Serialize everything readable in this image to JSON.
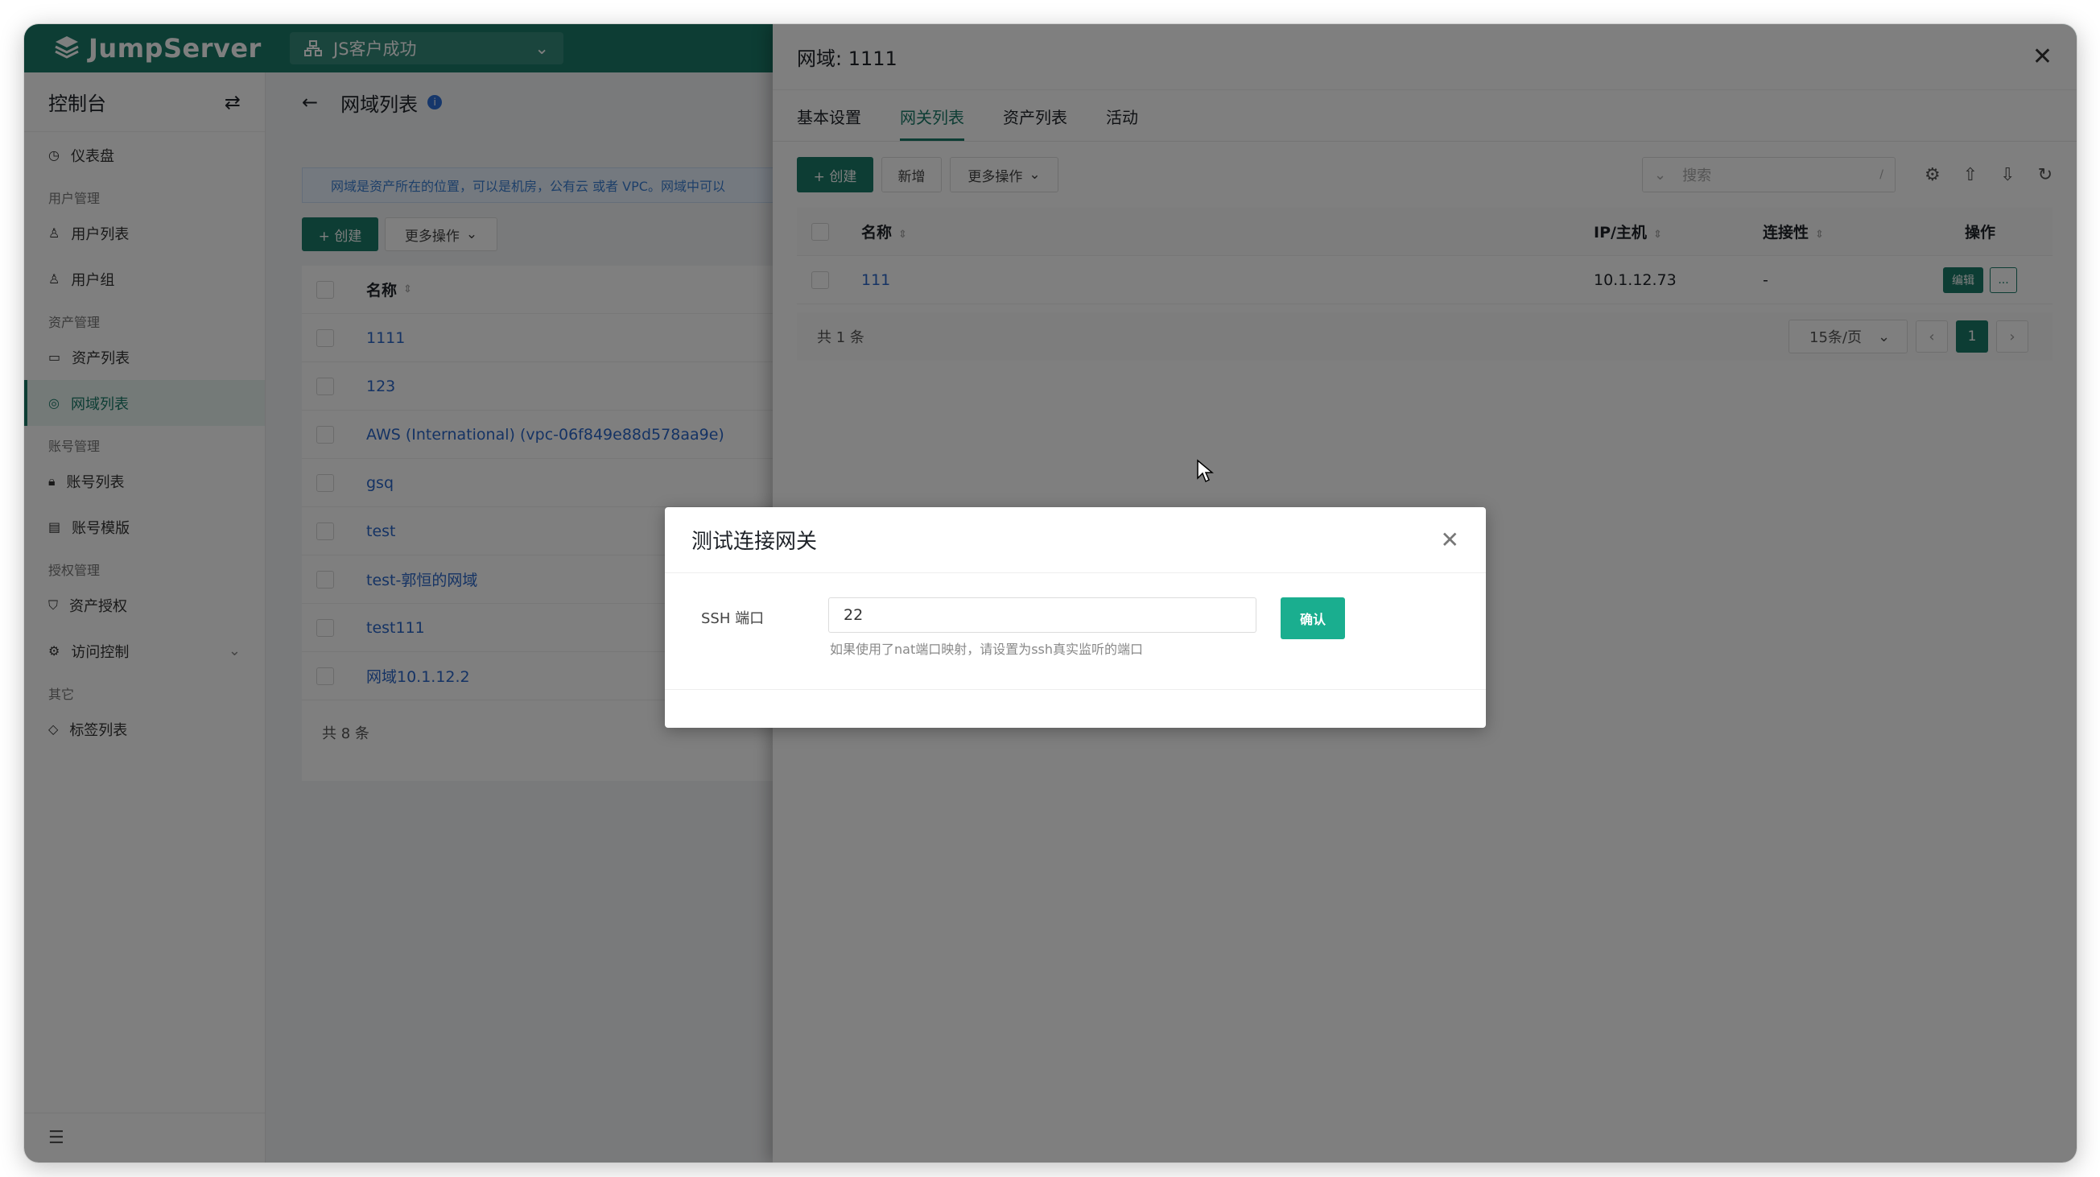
{
  "topbar": {
    "logo": "JumpServer",
    "org": "JS客户成功"
  },
  "sidebar": {
    "title": "控制台",
    "items": [
      {
        "type": "item",
        "label": "仪表盘",
        "icon": "dashboard-icon"
      },
      {
        "type": "group",
        "label": "用户管理"
      },
      {
        "type": "item",
        "label": "用户列表",
        "icon": "user-icon"
      },
      {
        "type": "item",
        "label": "用户组",
        "icon": "user-group-icon"
      },
      {
        "type": "group",
        "label": "资产管理"
      },
      {
        "type": "item",
        "label": "资产列表",
        "icon": "monitor-icon"
      },
      {
        "type": "item",
        "label": "网域列表",
        "icon": "location-icon",
        "active": true
      },
      {
        "type": "group",
        "label": "账号管理"
      },
      {
        "type": "item",
        "label": "账号列表",
        "icon": "lock-icon"
      },
      {
        "type": "item",
        "label": "账号模版",
        "icon": "template-icon"
      },
      {
        "type": "group",
        "label": "授权管理"
      },
      {
        "type": "item",
        "label": "资产授权",
        "icon": "shield-icon"
      },
      {
        "type": "item",
        "label": "访问控制",
        "icon": "access-control-icon",
        "expandable": true
      },
      {
        "type": "group",
        "label": "其它"
      },
      {
        "type": "item",
        "label": "标签列表",
        "icon": "tag-icon"
      }
    ]
  },
  "main": {
    "title": "网域列表",
    "tip": "网域是资产所在的位置，可以是机房，公有云 或者 VPC。网域中可以",
    "create_label": "+ 创建",
    "more_label": "更多操作",
    "col_name": "名称",
    "rows": [
      "1111",
      "123",
      "AWS (International) (vpc-06f849e88d578aa9e)",
      "gsq",
      "test",
      "test-郭恒的网域",
      "test111",
      "网域10.1.12.2"
    ],
    "total": "共 8 条"
  },
  "drawer": {
    "title": "网域: 1111",
    "tabs": [
      "基本设置",
      "网关列表",
      "资产列表",
      "活动"
    ],
    "active_tab": 1,
    "create_label": "+ 创建",
    "add_label": "新增",
    "more_label": "更多操作",
    "search_placeholder": "搜索",
    "search_shortcut": "/",
    "columns": {
      "name": "名称",
      "ip": "IP/主机",
      "conn": "连接性",
      "action": "操作"
    },
    "row": {
      "name": "111",
      "ip": "10.1.12.73",
      "conn": "-",
      "edit": "编辑",
      "more": "..."
    },
    "total": "共 1 条",
    "page_size": "15条/页",
    "page": "1"
  },
  "dialog": {
    "title": "测试连接网关",
    "label": "SSH 端口",
    "value": "22",
    "hint": "如果使用了nat端口映射，请设置为ssh真实监听的端口",
    "confirm": "确认"
  }
}
